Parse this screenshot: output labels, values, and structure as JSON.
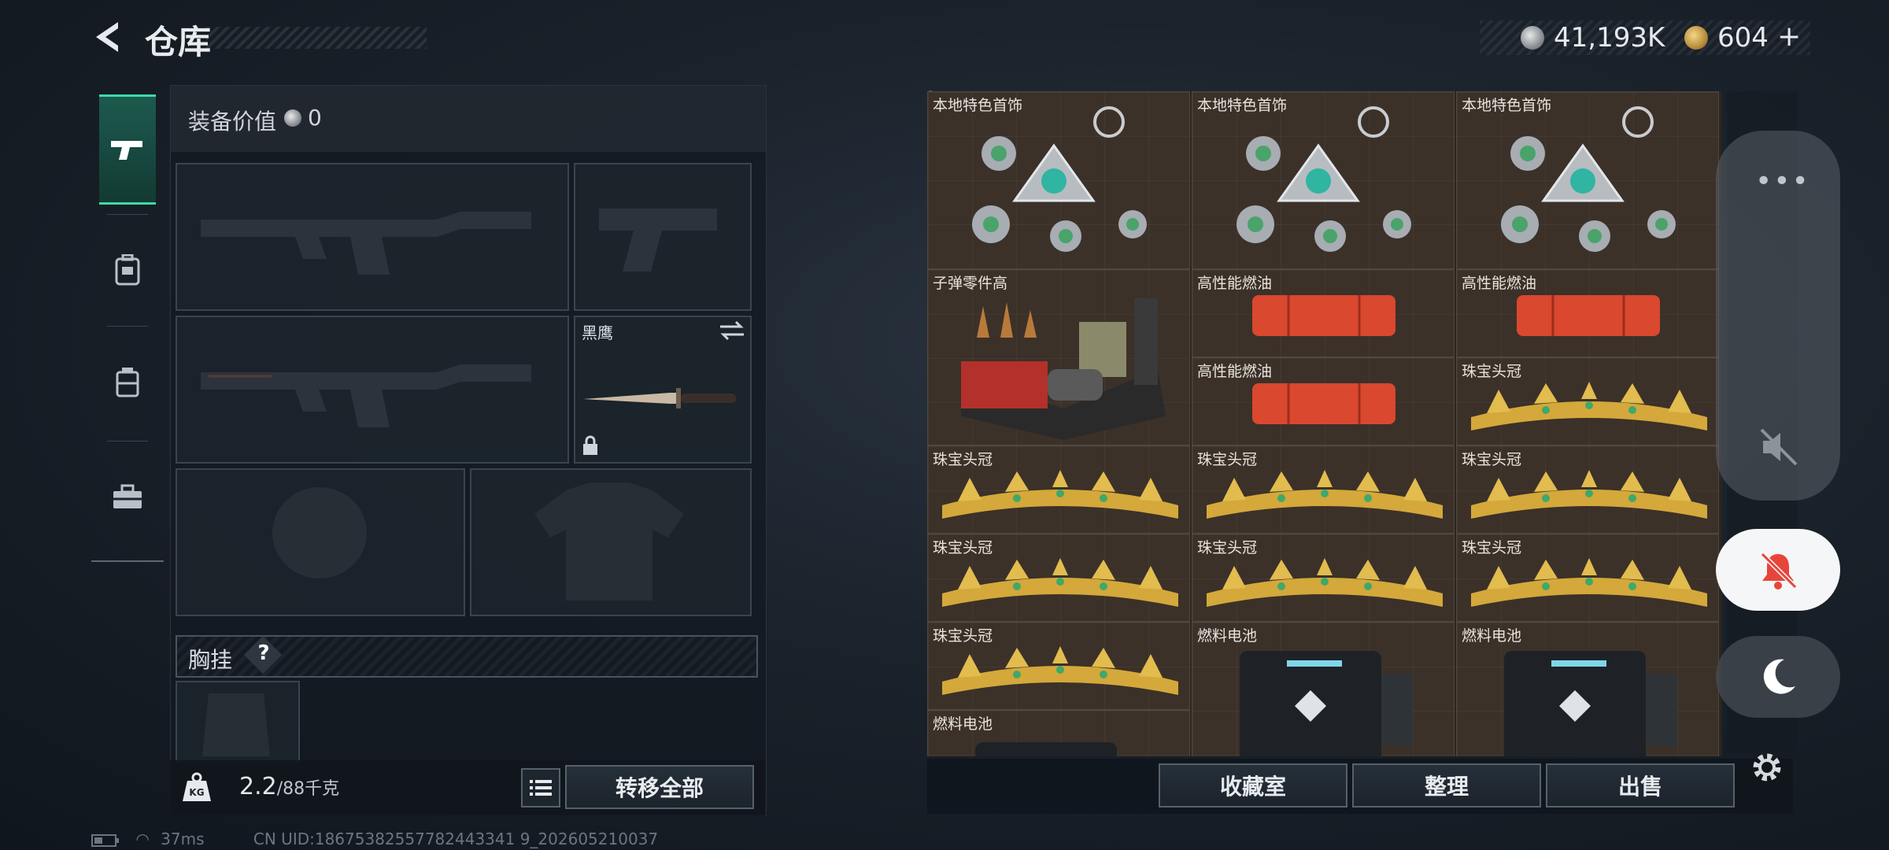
{
  "header": {
    "title": "仓库"
  },
  "currency": {
    "silver": "41,193K",
    "gold": "604"
  },
  "sidebar": {
    "tabs": [
      "weapons",
      "backpack",
      "chest-rig",
      "toolbox"
    ]
  },
  "equipment": {
    "value_label": "装备价值",
    "value": "0",
    "melee_name": "黑鹰",
    "chest_label": "胸挂",
    "help": "?"
  },
  "footer_left": {
    "weight": "2.2",
    "weight_max": "/88千克",
    "transfer_all": "转移全部"
  },
  "grid_items": [
    {
      "name": "本地特色首饰",
      "type": "amulet"
    },
    {
      "name": "本地特色首饰",
      "type": "amulet"
    },
    {
      "name": "本地特色首饰",
      "type": "amulet"
    },
    {
      "name": "子弹零件高",
      "type": "ammo-kit"
    },
    {
      "name": "高性能燃油",
      "type": "fuel"
    },
    {
      "name": "高性能燃油",
      "type": "fuel"
    },
    {
      "name": "高性能燃油",
      "type": "fuel"
    },
    {
      "name": "珠宝头冠",
      "type": "tiara"
    },
    {
      "name": "珠宝头冠",
      "type": "tiara"
    },
    {
      "name": "珠宝头冠",
      "type": "tiara"
    },
    {
      "name": "珠宝头冠",
      "type": "tiara"
    },
    {
      "name": "珠宝头冠",
      "type": "tiara"
    },
    {
      "name": "珠宝头冠",
      "type": "tiara"
    },
    {
      "name": "珠宝头冠",
      "type": "tiara"
    },
    {
      "name": "珠宝头冠",
      "type": "tiara"
    },
    {
      "name": "燃料电池",
      "type": "battery"
    },
    {
      "name": "燃料电池",
      "type": "battery"
    },
    {
      "name": "燃料电池",
      "type": "battery"
    }
  ],
  "footer_right": {
    "collection": "收藏室",
    "organize": "整理",
    "sell": "出售"
  },
  "status": {
    "ping": "37ms",
    "uid": "CN UID:18675382557782443341 9_202605210037"
  },
  "colors": {
    "accent": "#3fd9a8",
    "alert": "#e8453a"
  }
}
